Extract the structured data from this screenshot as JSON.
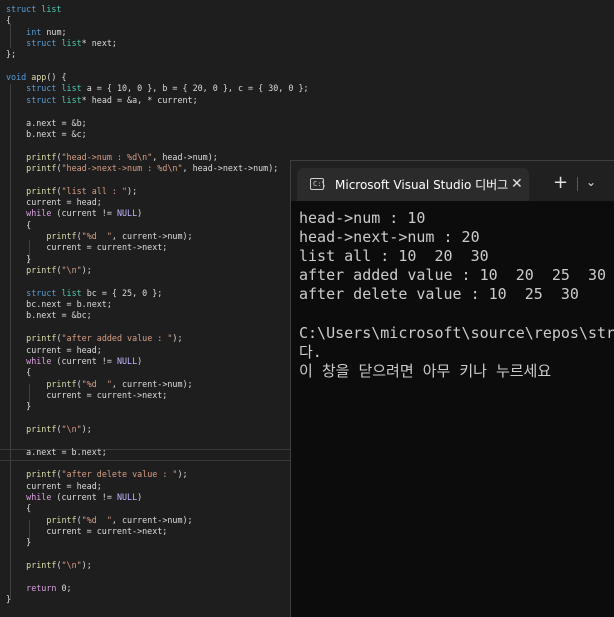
{
  "editor": {
    "lines": [
      [
        [
          "struct",
          "#569cd6"
        ],
        [
          " list",
          "#4ec9b0"
        ]
      ],
      [
        [
          "{",
          "#dcdcdc"
        ]
      ],
      [
        [
          "    ",
          "#dcdcdc"
        ],
        [
          "int",
          "#569cd6"
        ],
        [
          " num;",
          "#dcdcdc"
        ]
      ],
      [
        [
          "    ",
          "#dcdcdc"
        ],
        [
          "struct",
          "#569cd6"
        ],
        [
          " list",
          "#4ec9b0"
        ],
        [
          "* next;",
          "#dcdcdc"
        ]
      ],
      [
        [
          "};",
          "#dcdcdc"
        ]
      ],
      [],
      [
        [
          "void",
          "#569cd6"
        ],
        [
          " app",
          "#dcdcaa"
        ],
        [
          "() {",
          "#dcdcdc"
        ]
      ],
      [
        [
          "    ",
          "#dcdcdc"
        ],
        [
          "struct",
          "#569cd6"
        ],
        [
          " list",
          "#4ec9b0"
        ],
        [
          " a = { 10, 0 }, b = { 20, 0 }, c = { 30, 0 };",
          "#dcdcdc"
        ]
      ],
      [
        [
          "    ",
          "#dcdcdc"
        ],
        [
          "struct",
          "#569cd6"
        ],
        [
          " list",
          "#4ec9b0"
        ],
        [
          "* head = &a, * current;",
          "#dcdcdc"
        ]
      ],
      [],
      [
        [
          "    a.next = &b;",
          "#dcdcdc"
        ]
      ],
      [
        [
          "    b.next = &c;",
          "#dcdcdc"
        ]
      ],
      [],
      [
        [
          "    ",
          "#dcdcdc"
        ],
        [
          "printf",
          "#dcdcaa"
        ],
        [
          "(",
          "#dcdcdc"
        ],
        [
          "\"head->num : %d\\n\"",
          "#d69d85"
        ],
        [
          ", head->num);",
          "#dcdcdc"
        ]
      ],
      [
        [
          "    ",
          "#dcdcdc"
        ],
        [
          "printf",
          "#dcdcaa"
        ],
        [
          "(",
          "#dcdcdc"
        ],
        [
          "\"head->next->num : %d\\n\"",
          "#d69d85"
        ],
        [
          ", head->next->num);",
          "#dcdcdc"
        ]
      ],
      [],
      [
        [
          "    ",
          "#dcdcdc"
        ],
        [
          "printf",
          "#dcdcaa"
        ],
        [
          "(",
          "#dcdcdc"
        ],
        [
          "\"list all : \"",
          "#d69d85"
        ],
        [
          ");",
          "#dcdcdc"
        ]
      ],
      [
        [
          "    current = head;",
          "#dcdcdc"
        ]
      ],
      [
        [
          "    ",
          "#dcdcdc"
        ],
        [
          "while",
          "#d8a0df"
        ],
        [
          " (current != ",
          "#dcdcdc"
        ],
        [
          "NULL",
          "#beb7ff"
        ],
        [
          ")",
          "#dcdcdc"
        ]
      ],
      [
        [
          "    {",
          "#dcdcdc"
        ]
      ],
      [
        [
          "        ",
          "#dcdcdc"
        ],
        [
          "printf",
          "#dcdcaa"
        ],
        [
          "(",
          "#dcdcdc"
        ],
        [
          "\"%d  \"",
          "#d69d85"
        ],
        [
          ", current->num);",
          "#dcdcdc"
        ]
      ],
      [
        [
          "        current = current->next;",
          "#dcdcdc"
        ]
      ],
      [
        [
          "    }",
          "#dcdcdc"
        ]
      ],
      [
        [
          "    ",
          "#dcdcdc"
        ],
        [
          "printf",
          "#dcdcaa"
        ],
        [
          "(",
          "#dcdcdc"
        ],
        [
          "\"\\n\"",
          "#d69d85"
        ],
        [
          ");",
          "#dcdcdc"
        ]
      ],
      [],
      [
        [
          "    ",
          "#dcdcdc"
        ],
        [
          "struct",
          "#569cd6"
        ],
        [
          " list",
          "#4ec9b0"
        ],
        [
          " bc = { 25, 0 };",
          "#dcdcdc"
        ]
      ],
      [
        [
          "    bc.next = b.next;",
          "#dcdcdc"
        ]
      ],
      [
        [
          "    b.next = &bc;",
          "#dcdcdc"
        ]
      ],
      [],
      [
        [
          "    ",
          "#dcdcdc"
        ],
        [
          "printf",
          "#dcdcaa"
        ],
        [
          "(",
          "#dcdcdc"
        ],
        [
          "\"after added value : \"",
          "#d69d85"
        ],
        [
          ");",
          "#dcdcdc"
        ]
      ],
      [
        [
          "    current = head;",
          "#dcdcdc"
        ]
      ],
      [
        [
          "    ",
          "#dcdcdc"
        ],
        [
          "while",
          "#d8a0df"
        ],
        [
          " (current != ",
          "#dcdcdc"
        ],
        [
          "NULL",
          "#beb7ff"
        ],
        [
          ")",
          "#dcdcdc"
        ]
      ],
      [
        [
          "    {",
          "#dcdcdc"
        ]
      ],
      [
        [
          "        ",
          "#dcdcdc"
        ],
        [
          "printf",
          "#dcdcaa"
        ],
        [
          "(",
          "#dcdcdc"
        ],
        [
          "\"%d  \"",
          "#d69d85"
        ],
        [
          ", current->num);",
          "#dcdcdc"
        ]
      ],
      [
        [
          "        current = current->next;",
          "#dcdcdc"
        ]
      ],
      [
        [
          "    }",
          "#dcdcdc"
        ]
      ],
      [],
      [
        [
          "    ",
          "#dcdcdc"
        ],
        [
          "printf",
          "#dcdcaa"
        ],
        [
          "(",
          "#dcdcdc"
        ],
        [
          "\"\\n\"",
          "#d69d85"
        ],
        [
          ");",
          "#dcdcdc"
        ]
      ],
      [],
      [
        [
          "    a.next = b.next;",
          "#dcdcdc"
        ]
      ],
      [],
      [
        [
          "    ",
          "#dcdcdc"
        ],
        [
          "printf",
          "#dcdcaa"
        ],
        [
          "(",
          "#dcdcdc"
        ],
        [
          "\"after delete value : \"",
          "#d69d85"
        ],
        [
          ");",
          "#dcdcdc"
        ]
      ],
      [
        [
          "    current = head;",
          "#dcdcdc"
        ]
      ],
      [
        [
          "    ",
          "#dcdcdc"
        ],
        [
          "while",
          "#d8a0df"
        ],
        [
          " (current != ",
          "#dcdcdc"
        ],
        [
          "NULL",
          "#beb7ff"
        ],
        [
          ")",
          "#dcdcdc"
        ]
      ],
      [
        [
          "    {",
          "#dcdcdc"
        ]
      ],
      [
        [
          "        ",
          "#dcdcdc"
        ],
        [
          "printf",
          "#dcdcaa"
        ],
        [
          "(",
          "#dcdcdc"
        ],
        [
          "\"%d  \"",
          "#d69d85"
        ],
        [
          ", current->num);",
          "#dcdcdc"
        ]
      ],
      [
        [
          "        current = current->next;",
          "#dcdcdc"
        ]
      ],
      [
        [
          "    }",
          "#dcdcdc"
        ]
      ],
      [],
      [
        [
          "    ",
          "#dcdcdc"
        ],
        [
          "printf",
          "#dcdcaa"
        ],
        [
          "(",
          "#dcdcdc"
        ],
        [
          "\"\\n\"",
          "#d69d85"
        ],
        [
          ");",
          "#dcdcdc"
        ]
      ],
      [],
      [
        [
          "    ",
          "#dcdcdc"
        ],
        [
          "return",
          "#d8a0df"
        ],
        [
          " 0;",
          "#dcdcdc"
        ]
      ],
      [
        [
          "}",
          "#dcdcdc"
        ]
      ]
    ]
  },
  "terminal": {
    "tab_icon_text": "C:\\",
    "tab_title": "Microsoft Visual Studio 디버그",
    "close_glyph": "✕",
    "new_tab_glyph": "+",
    "dropdown_glyph": "⌄",
    "output_lines": [
      "head->num : 10",
      "head->next->num : 20",
      "list all : 10  20  30",
      "after added value : 10  20  25  30",
      "after delete value : 10  25  30",
      "",
      "C:\\Users\\microsoft\\source\\repos\\str",
      "다.",
      "이 창을 닫으려면 아무 키나 누르세요"
    ]
  },
  "colors": {
    "editor_bg": "#1e1e1e",
    "terminal_bg": "#0c0c0c",
    "keyword": "#569cd6",
    "type": "#4ec9b0",
    "function": "#dcdcaa",
    "string": "#d69d85",
    "control": "#d8a0df"
  }
}
